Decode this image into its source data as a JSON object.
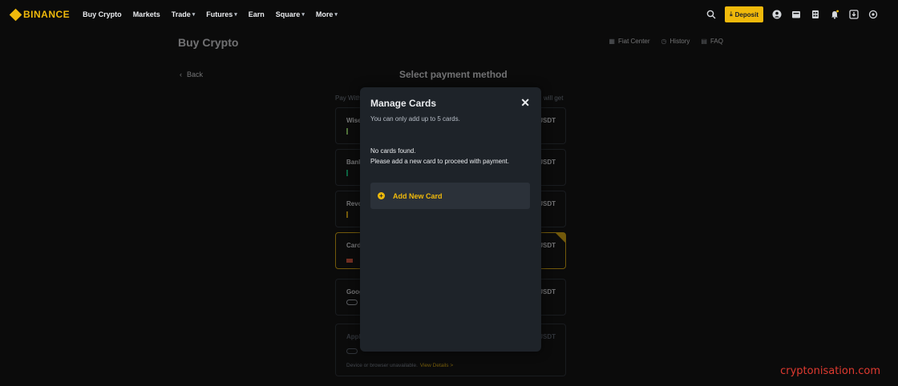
{
  "nav": {
    "brand": "BINANCE",
    "items": [
      {
        "label": "Buy Crypto",
        "chevron": false
      },
      {
        "label": "Markets",
        "chevron": false
      },
      {
        "label": "Trade",
        "chevron": true
      },
      {
        "label": "Futures",
        "chevron": true
      },
      {
        "label": "Earn",
        "chevron": false
      },
      {
        "label": "Square",
        "chevron": true
      },
      {
        "label": "More",
        "chevron": true
      }
    ],
    "deposit_label": "Deposit"
  },
  "page": {
    "title": "Buy Crypto",
    "links": [
      "Fiat Center",
      "History",
      "FAQ"
    ],
    "back_label": "Back",
    "section_title": "Select payment method",
    "pay_with": "Pay With",
    "will_get": "will get"
  },
  "methods": [
    {
      "label": "Wise",
      "currency": "USDT"
    },
    {
      "label": "Bank",
      "currency": "USDT"
    },
    {
      "label": "Revo",
      "currency": "USDT"
    },
    {
      "label": "Card",
      "currency": "USDT"
    },
    {
      "label": "Goog",
      "currency": "USDT"
    },
    {
      "label": "Appl",
      "currency": "USDT",
      "note": "Device or browser unavailable.",
      "note_link": "View Details >"
    }
  ],
  "modal": {
    "title": "Manage Cards",
    "subtitle": "You can only add up to 5 cards.",
    "empty_line1": "No cards found.",
    "empty_line2": "Please add a new card to proceed with payment.",
    "add_label": "Add New Card"
  },
  "watermark": "cryptonisation.com",
  "colors": {
    "accent": "#f0b90b",
    "modal_bg": "#1e2329",
    "page_bg": "#0b0b0b"
  }
}
